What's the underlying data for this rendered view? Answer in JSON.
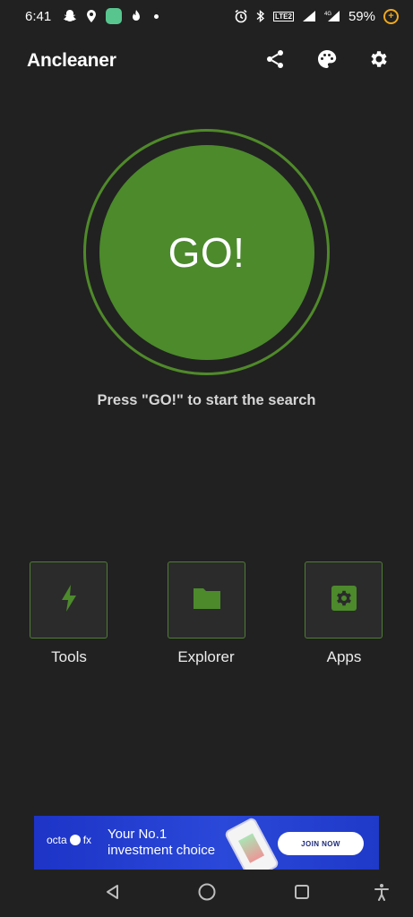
{
  "status_bar": {
    "time": "6:41",
    "battery": "59%",
    "icons": [
      "snapchat-icon",
      "location-icon",
      "chat-icon",
      "tinder-icon",
      "notification-dot",
      "alarm-icon",
      "bluetooth-icon",
      "volte-icon",
      "signal-icon",
      "4g-signal-icon",
      "battery-saver-icon"
    ],
    "lte_label": "LTE2"
  },
  "app_bar": {
    "title": "Ancleaner",
    "actions": [
      "share-icon",
      "palette-icon",
      "settings-icon"
    ]
  },
  "main": {
    "go_label": "GO!",
    "hint": "Press \"GO!\" to start the search"
  },
  "tiles": [
    {
      "label": "Tools",
      "icon": "lightning-icon"
    },
    {
      "label": "Explorer",
      "icon": "folder-icon"
    },
    {
      "label": "Apps",
      "icon": "app-settings-icon"
    }
  ],
  "ad": {
    "brand": "octa",
    "brand_suffix": "fx",
    "headline_line1": "Your No.1",
    "headline_line2": "investment choice",
    "cta": "JOIN NOW"
  },
  "nav_bar": {
    "buttons": [
      "back-icon",
      "home-icon",
      "recents-icon",
      "accessibility-icon"
    ]
  },
  "colors": {
    "background": "#212121",
    "accent": "#4c8a2c",
    "tile_border": "#4e7e33",
    "ad_blue": "#2a48d9"
  }
}
